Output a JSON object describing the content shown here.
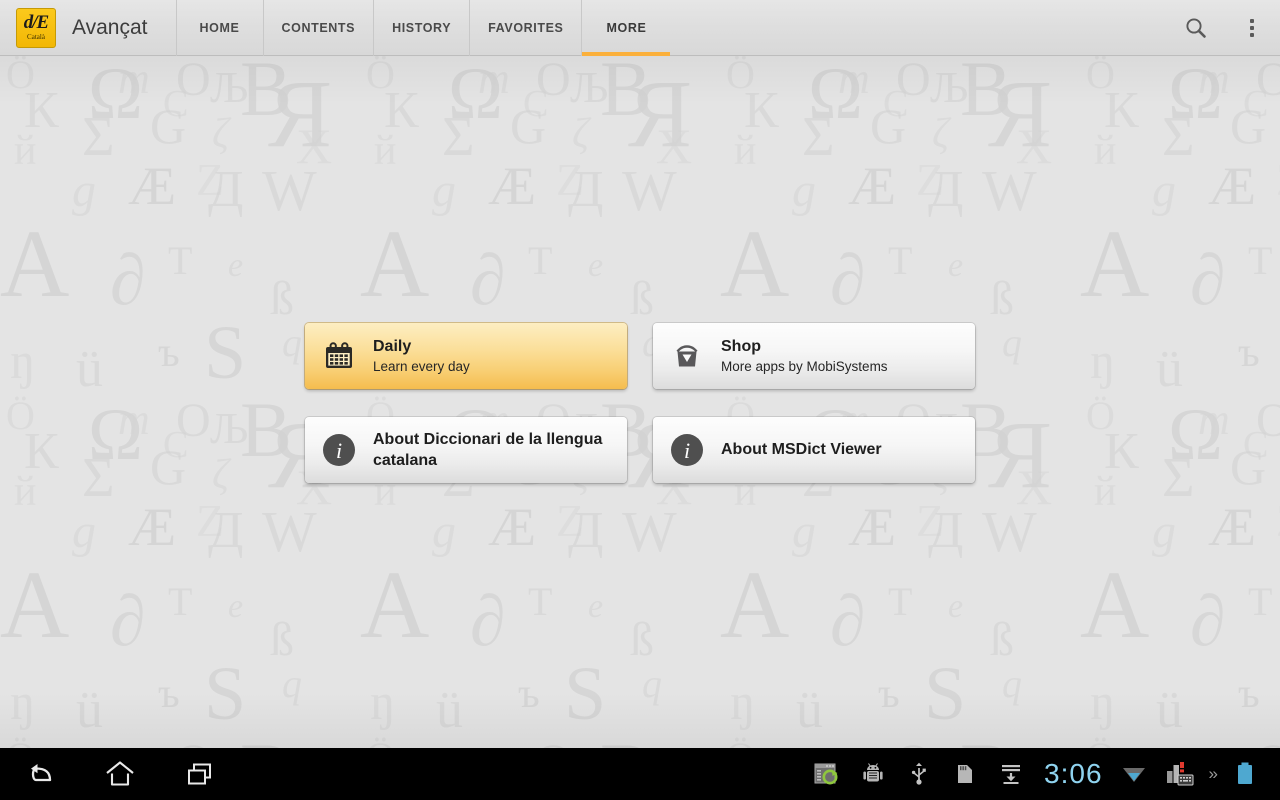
{
  "app": {
    "icon_mono": "d/E",
    "icon_lang": "Català",
    "title": "Avançat"
  },
  "tabs": [
    {
      "label": "HOME",
      "active": false
    },
    {
      "label": "CONTENTS",
      "active": false
    },
    {
      "label": "HISTORY",
      "active": false
    },
    {
      "label": "FAVORITES",
      "active": false
    },
    {
      "label": "MORE",
      "active": true
    }
  ],
  "action_bar": {
    "search_icon": "search-icon",
    "overflow_icon": "overflow-menu-icon",
    "accent_color": "#fbb03b",
    "background_color": "#dedede"
  },
  "menu": {
    "cards": [
      {
        "id": "daily",
        "icon": "calendar-icon",
        "title": "Daily",
        "subtitle": "Learn every day",
        "highlighted": true
      },
      {
        "id": "shop",
        "icon": "shopping-bag-icon",
        "title": "Shop",
        "subtitle": "More apps by MobiSystems",
        "highlighted": false
      },
      {
        "id": "about-dictionary",
        "icon": "info-icon",
        "title": "About Diccionari de la llengua catalana",
        "subtitle": "",
        "highlighted": false
      },
      {
        "id": "about-viewer",
        "icon": "info-icon",
        "title": "About MSDict Viewer",
        "subtitle": "",
        "highlighted": false
      }
    ]
  },
  "background": {
    "description": "tiled letterform wallpaper",
    "base_color": "#e4e4e4",
    "glyph_color": "#d2d2d2",
    "glyphs": [
      "Ö",
      "Ω",
      "Љ",
      "Я",
      "й",
      "C",
      "Æ",
      "g",
      "Д",
      "W",
      "A",
      "∂",
      "T",
      "е",
      "ß",
      "ŋ",
      "ü",
      "ъ",
      "S",
      "q",
      "m",
      "O",
      "B",
      "К",
      "Σ",
      "G",
      "ζ",
      "Χ",
      "Z"
    ]
  },
  "system_bar": {
    "back_icon": "back-icon",
    "home_icon": "home-icon",
    "recents_icon": "recents-icon",
    "status_icons": [
      "screen-capture-icon",
      "android-debug-icon",
      "usb-icon",
      "sd-card-icon",
      "download-icon"
    ],
    "clock": "3:06",
    "clock_color": "#8fd3ef",
    "wifi_icon": "wifi-icon",
    "signal_alert_icon": "signal-alert-icon",
    "keyboard_icon": "keyboard-icon",
    "expand_chevrons": "»",
    "battery_icon": "battery-icon"
  }
}
